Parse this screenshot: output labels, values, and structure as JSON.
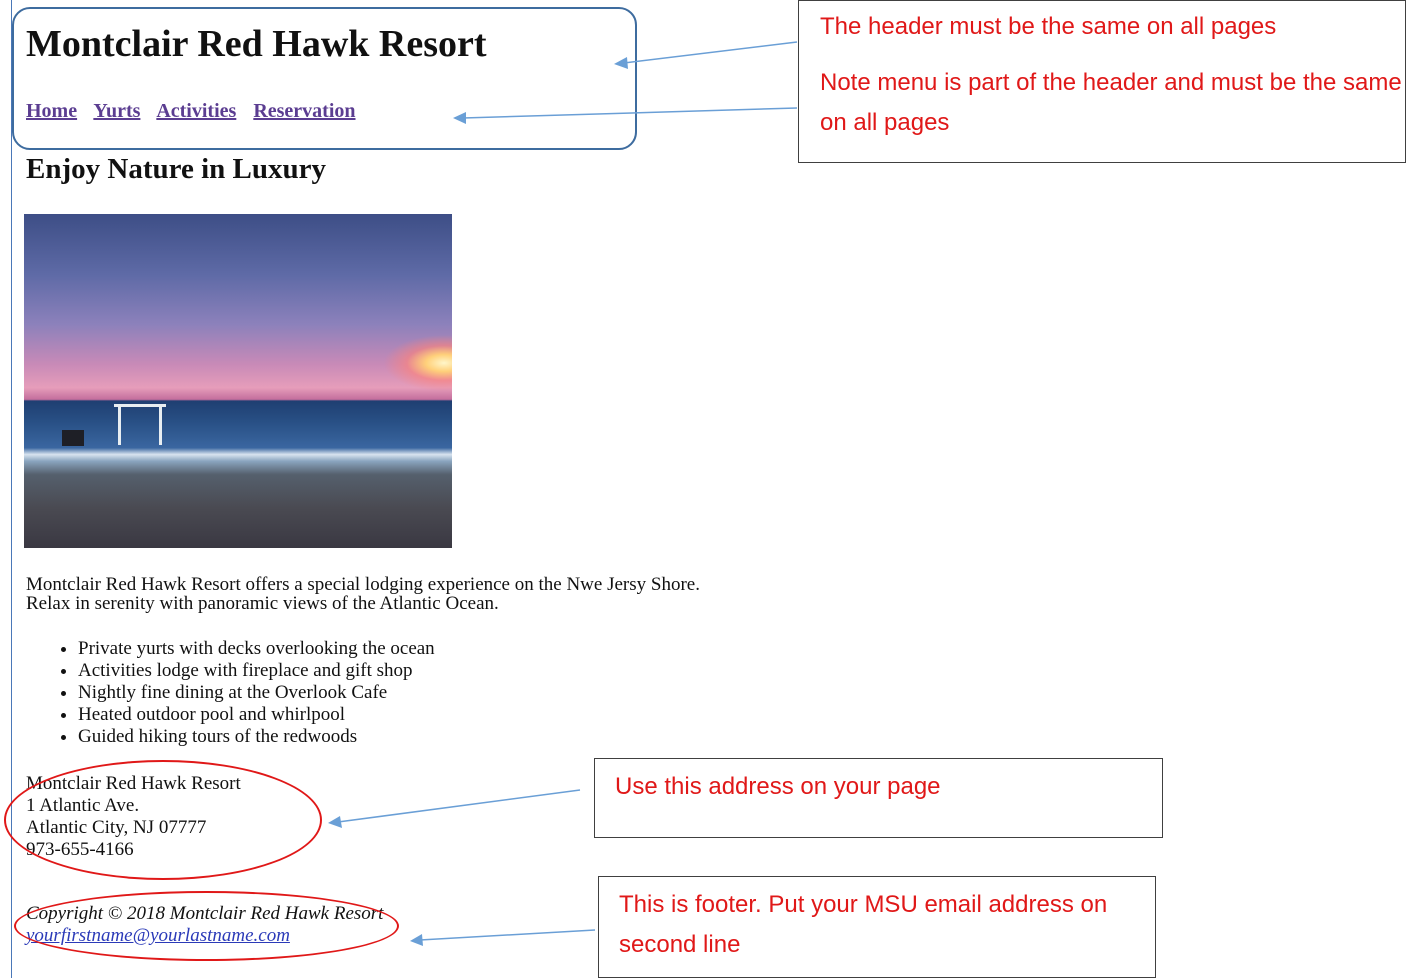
{
  "site": {
    "title": "Montclair Red Hawk Resort",
    "nav": [
      {
        "label": "Home"
      },
      {
        "label": "Yurts"
      },
      {
        "label": "Activities"
      },
      {
        "label": "Reservation"
      }
    ],
    "subtitle": "Enjoy Nature in Luxury"
  },
  "content": {
    "intro_line1": "Montclair Red Hawk Resort offers a special lodging experience on the Nwe Jersy Shore.",
    "intro_line2": "Relax in serenity with panoramic views of the Atlantic Ocean.",
    "features": [
      "Private yurts with decks overlooking the ocean",
      "Activities lodge with fireplace and gift shop",
      "Nightly fine dining at the Overlook Cafe",
      "Heated outdoor pool and whirlpool",
      "Guided hiking tours of the redwoods"
    ]
  },
  "address": {
    "name": "Montclair Red Hawk Resort",
    "street": "1 Atlantic Ave.",
    "city": "Atlantic City, NJ  07777",
    "phone": "973-655-4166"
  },
  "footer": {
    "copyright": "Copyright © 2018 Montclair Red Hawk Resort",
    "email": "yourfirstname@yourlastname.com"
  },
  "annotations": {
    "header_note": "The header must be the same on all pages",
    "menu_note": "Note menu is part of the header and must be the same on all pages",
    "address_note": "Use this address on your page",
    "footer_note": "This is footer. Put your MSU email address on second line",
    "text_color": "#e01818",
    "outline_color": "#3e6c9f"
  }
}
